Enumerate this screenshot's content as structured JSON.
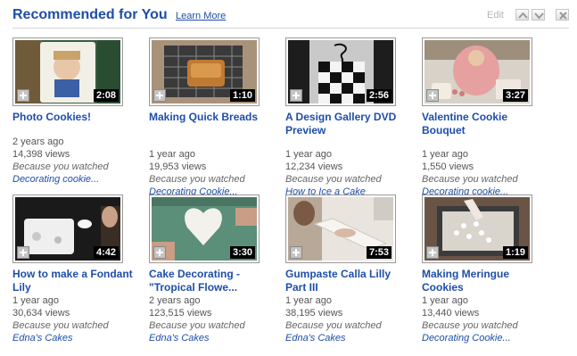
{
  "header": {
    "title": "Recommended for You",
    "learn_more": "Learn More",
    "edit": "Edit"
  },
  "videos": [
    {
      "title": "Photo Cookies!",
      "duration": "2:08",
      "age": "2 years ago",
      "views": "14,398 views",
      "because": "Because you watched",
      "source": "Decorating cookie..."
    },
    {
      "title": "Making Quick Breads",
      "duration": "1:10",
      "age": "1 year ago",
      "views": "19,953 views",
      "because": "Because you watched",
      "source": "Decorating Cookie..."
    },
    {
      "title": "A Design Gallery DVD Preview",
      "duration": "2:56",
      "age": "1 year ago",
      "views": "12,234 views",
      "because": "Because you watched",
      "source": "How to Ice a Cake"
    },
    {
      "title": "Valentine Cookie Bouquet",
      "duration": "3:27",
      "age": "1 year ago",
      "views": "1,550 views",
      "because": "Because you watched",
      "source": "Decorating cookie..."
    },
    {
      "title": "How to make a Fondant Lily",
      "duration": "4:42",
      "age": "1 year ago",
      "views": "30,634 views",
      "because": "Because you watched",
      "source": "Edna's Cakes"
    },
    {
      "title": "Cake Decorating - \"Tropical Flowe...",
      "duration": "3:30",
      "age": "2 years ago",
      "views": "123,515 views",
      "because": "Because you watched",
      "source": "Edna's Cakes"
    },
    {
      "title": "Gumpaste Calla Lilly Part III",
      "duration": "7:53",
      "age": "1 year ago",
      "views": "38,195 views",
      "because": "Because you watched",
      "source": "Edna's Cakes"
    },
    {
      "title": "Making Meringue Cookies",
      "duration": "1:19",
      "age": "1 year ago",
      "views": "13,440 views",
      "because": "Because you watched",
      "source": "Decorating Cookie..."
    }
  ],
  "icons": {
    "move_up": "chevron-up-icon",
    "move_down": "chevron-down-icon",
    "close": "close-icon",
    "add": "add-to-queue-icon"
  }
}
